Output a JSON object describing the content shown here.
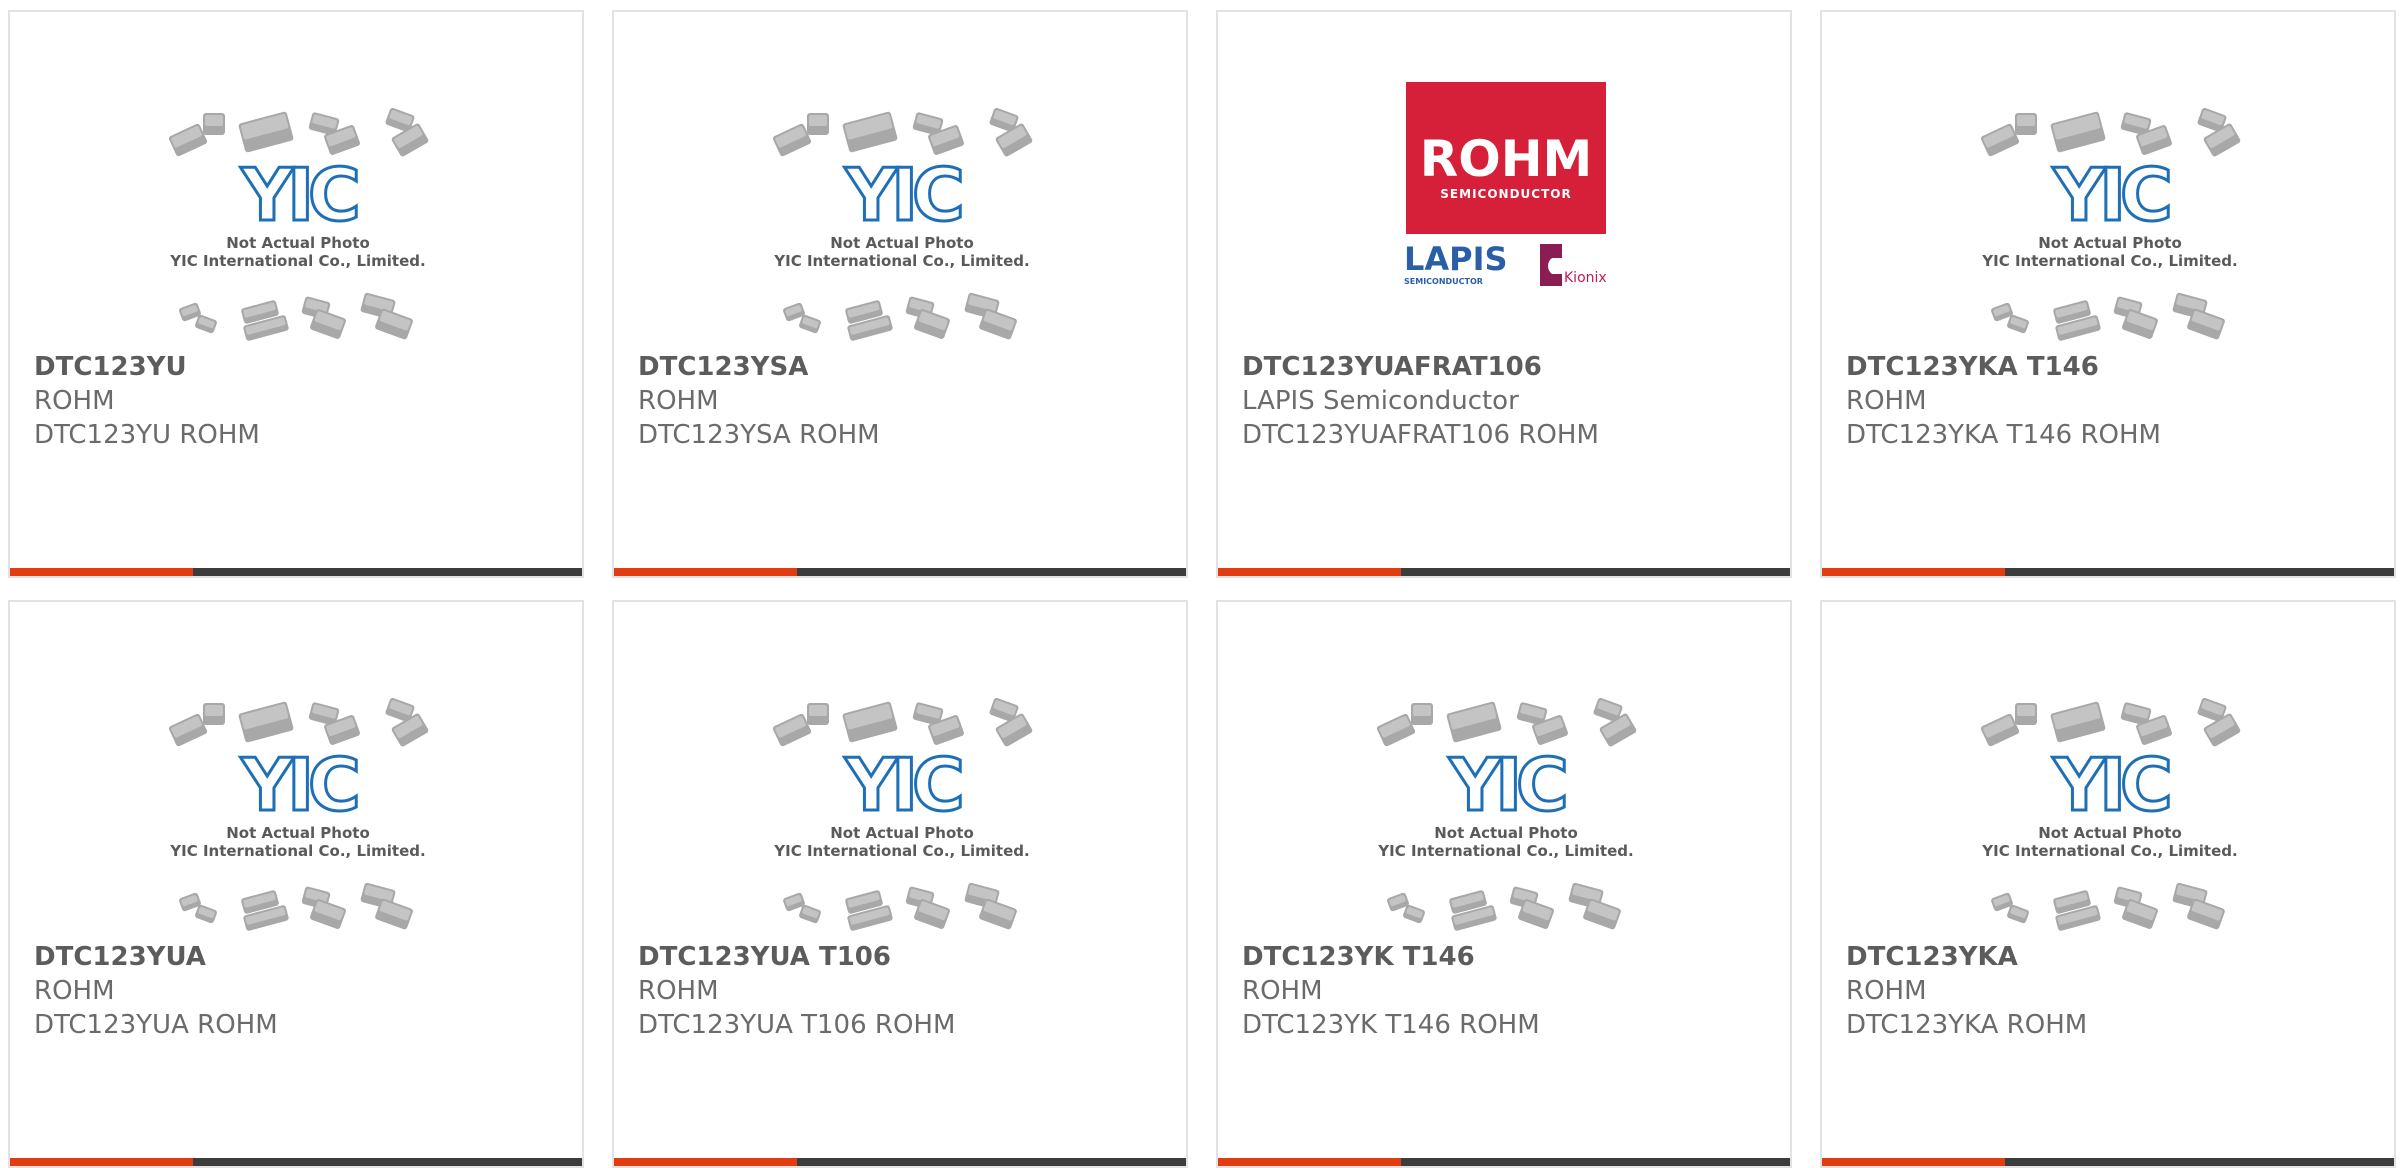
{
  "colors": {
    "accent": "#e23d12",
    "bar": "#3c3c3c",
    "text": "#6b6b6b",
    "yic_blue": "#1e6fb5",
    "rohm_red": "#d6203a"
  },
  "placeholder": {
    "line1": "Not Actual Photo",
    "line2": "YIC International Co., Limited.",
    "logo": "YIC"
  },
  "rohm_logo": {
    "brand": "ROHM",
    "sub": "SEMICONDUCTOR",
    "lapis": "LAPIS",
    "lapis_sub": "SEMICONDUCTOR",
    "kionix": "Kionix"
  },
  "products": [
    {
      "part": "DTC123YU",
      "maker": "ROHM",
      "desc": "DTC123YU ROHM",
      "image": "placeholder"
    },
    {
      "part": "DTC123YSA",
      "maker": "ROHM",
      "desc": "DTC123YSA ROHM",
      "image": "placeholder"
    },
    {
      "part": "DTC123YUAFRAT106",
      "maker": "LAPIS Semiconductor",
      "desc": "DTC123YUAFRAT106 ROHM",
      "image": "rohm-logo"
    },
    {
      "part": "DTC123YKA T146",
      "maker": "ROHM",
      "desc": "DTC123YKA T146 ROHM",
      "image": "placeholder"
    },
    {
      "part": "DTC123YUA",
      "maker": "ROHM",
      "desc": "DTC123YUA ROHM",
      "image": "placeholder"
    },
    {
      "part": "DTC123YUA T106",
      "maker": "ROHM",
      "desc": "DTC123YUA T106 ROHM",
      "image": "placeholder"
    },
    {
      "part": "DTC123YK T146",
      "maker": "ROHM",
      "desc": "DTC123YK T146 ROHM",
      "image": "placeholder"
    },
    {
      "part": "DTC123YKA",
      "maker": "ROHM",
      "desc": "DTC123YKA ROHM",
      "image": "placeholder"
    }
  ]
}
